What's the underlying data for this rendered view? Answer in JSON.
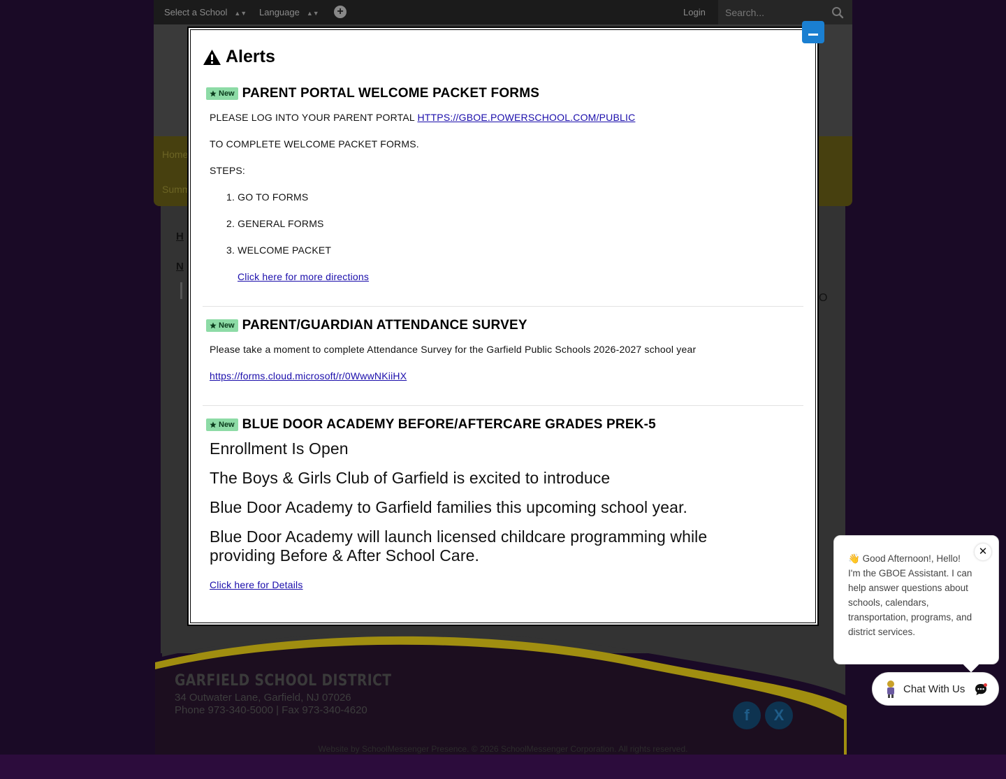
{
  "topbar": {
    "select_school": "Select a School",
    "language": "Language",
    "login": "Login",
    "search_placeholder": "Search..."
  },
  "nav": {
    "item1": "Home",
    "item2": "Summ"
  },
  "content": {
    "frag1": "H",
    "frag2": "N",
    "frag3": "O"
  },
  "modal": {
    "title": "Alerts",
    "badge": "New",
    "alerts": [
      {
        "title": "PARENT PORTAL WELCOME PACKET FORMS",
        "line1_prefix": "PLEASE LOG INTO YOUR PARENT PORTAL ",
        "line1_link": "HTTPS://GBOE.POWERSCHOOL.COM/PUBLIC",
        "line2": "TO COMPLETE WELCOME PACKET FORMS.",
        "steps_label": "STEPS:",
        "steps": [
          "1. GO TO FORMS",
          "2. GENERAL FORMS",
          "3. WELCOME PACKET"
        ],
        "link": "Click here for more directions"
      },
      {
        "title": "PARENT/GUARDIAN ATTENDANCE SURVEY",
        "line1": "Please take a moment to complete Attendance Survey for the Garfield Public Schools 2026-2027 school year",
        "link": "https://forms.cloud.microsoft/r/0WwwNKiiHX"
      },
      {
        "title": "BLUE DOOR ACADEMY BEFORE/AFTERCARE GRADES PREK-5",
        "p1": "Enrollment Is Open",
        "p2": "The Boys & Girls Club of Garfield is excited to introduce",
        "p3": "Blue Door Academy to Garfield families this upcoming school year.",
        "p4": "Blue Door Academy will launch licensed childcare programming while providing Before & After School Care.",
        "link": "Click here for Details"
      }
    ]
  },
  "footer": {
    "district": "GARFIELD SCHOOL DISTRICT",
    "address": "34 Outwater Lane, Garfield, NJ 07026",
    "phone": "Phone 973-340-5000 | Fax 973-340-4620",
    "facebook": "f",
    "twitter": "X",
    "copyright_prefix": "Website by ",
    "copyright_link": "SchoolMessenger Presence",
    "copyright_suffix": ". © 2026 SchoolMessenger Corporation. All rights reserved."
  },
  "chat": {
    "greeting": "Good Afternoon!, Hello! I'm the GBOE Assistant. I can help answer questions about schools, calendars, transportation, programs, and district services.",
    "wave": "👋",
    "close": "✕",
    "button_label": "Chat With Us"
  },
  "colors": {
    "badge_green": "#8ddba6",
    "close_blue": "#1a7fd1",
    "link_blue": "#1a0dab",
    "footer_yellow": "#a08e10"
  }
}
